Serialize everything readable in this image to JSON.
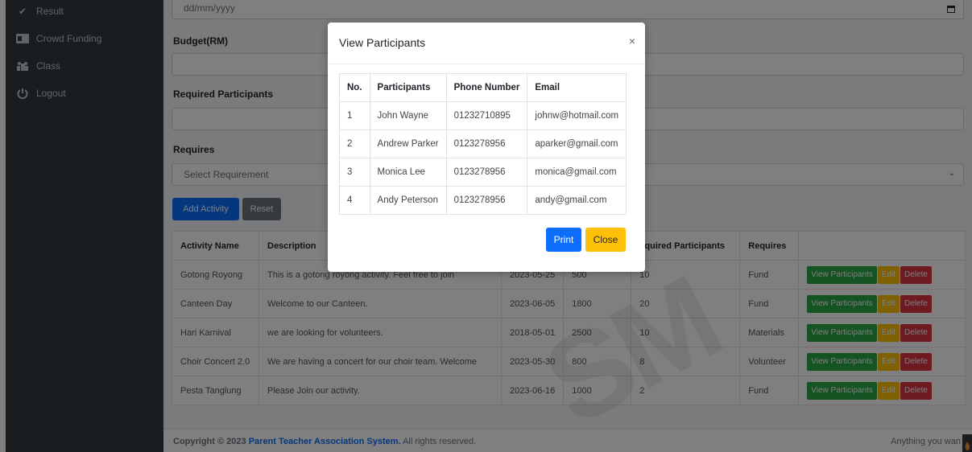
{
  "sidebar": {
    "items": [
      {
        "label": "Result",
        "icon": "check-icon"
      },
      {
        "label": "Crowd Funding",
        "icon": "id-card-icon"
      },
      {
        "label": "Class",
        "icon": "group-icon"
      },
      {
        "label": "Logout",
        "icon": "power-icon"
      }
    ]
  },
  "form": {
    "date_placeholder": "dd/mm/yyyy",
    "budget_label": "Budget(RM)",
    "participants_label": "Required Participants",
    "requires_label": "Requires",
    "requires_select": "Select Requirement",
    "add_button": "Add Activity",
    "reset_button": "Reset"
  },
  "activities": {
    "headers": [
      "Activity Name",
      "Description",
      "",
      "",
      "equired Participants",
      "Requires",
      ""
    ],
    "rows": [
      {
        "name": "Gotong Royong",
        "description": "This is a gotong royong activity. Feel free to join",
        "date": "2023-05-25",
        "budget": "500",
        "participants": "10",
        "requires": "Fund"
      },
      {
        "name": "Canteen Day",
        "description": "Welcome to our Canteen.",
        "date": "2023-06-05",
        "budget": "1800",
        "participants": "20",
        "requires": "Fund"
      },
      {
        "name": "Hari Karnival",
        "description": "we are looking for volunteers.",
        "date": "2018-05-01",
        "budget": "2500",
        "participants": "10",
        "requires": "Materials"
      },
      {
        "name": "Choir Concert 2.0",
        "description": "We are having a concert for our choir team. Welcome",
        "date": "2023-05-30",
        "budget": "800",
        "participants": "8",
        "requires": "Volunteer"
      },
      {
        "name": "Pesta Tanglung",
        "description": "Please Join our activity.",
        "date": "2023-06-16",
        "budget": "1000",
        "participants": "2",
        "requires": "Fund"
      }
    ],
    "view_label": "View Participants",
    "edit_label": "Edit",
    "delete_label": "Delete"
  },
  "footer": {
    "copyright": "Copyright © 2023",
    "system_name": "Parent Teacher Association System.",
    "rights": "All rights reserved.",
    "right_text": "Anything you wan"
  },
  "modal": {
    "title": "View Participants",
    "close_symbol": "×",
    "headers": [
      "No.",
      "Participants",
      "Phone Number",
      "Email"
    ],
    "rows": [
      {
        "no": "1",
        "name": "John Wayne",
        "phone": "01232710895",
        "email": "johnw@hotmail.com"
      },
      {
        "no": "2",
        "name": "Andrew Parker",
        "phone": "0123278956",
        "email": "aparker@gmail.com"
      },
      {
        "no": "3",
        "name": "Monica Lee",
        "phone": "0123278956",
        "email": "monica@gmail.com"
      },
      {
        "no": "4",
        "name": "Andy Peterson",
        "phone": "0123278956",
        "email": "andy@gmail.com"
      }
    ],
    "print_button": "Print",
    "close_button": "Close"
  },
  "watermark": "SM",
  "colors": {
    "sidebar": "#343a40",
    "primary": "#0d6efd",
    "warning": "#ffc107",
    "success": "#28a745",
    "danger": "#dc3545",
    "secondary": "#6c757d"
  }
}
